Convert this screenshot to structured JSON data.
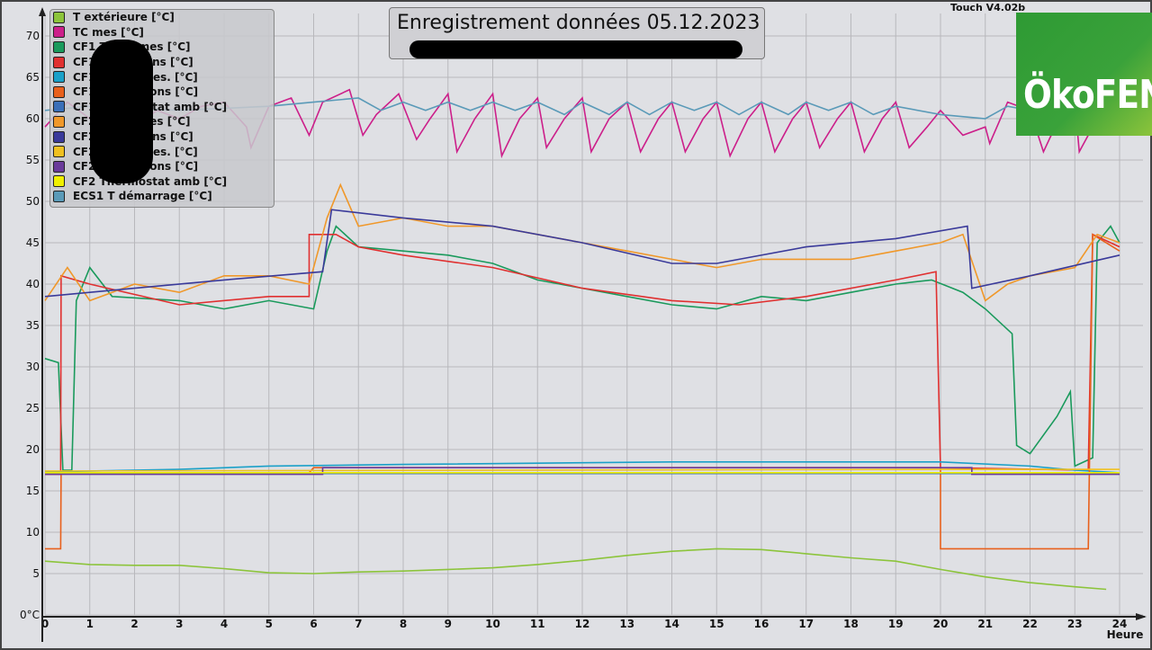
{
  "header": {
    "title": "Enregistrement données  05.12.2023",
    "version": "Touch V4.02b",
    "logo": "ÖkoFEN"
  },
  "chart_data": {
    "type": "line",
    "title": "Enregistrement données  05.12.2023",
    "xlabel": "Heure",
    "ylabel": "°C",
    "xlim": [
      0,
      24
    ],
    "ylim": [
      0,
      70
    ],
    "xticks": [
      "0",
      "1",
      "2",
      "3",
      "4",
      "5",
      "6",
      "7",
      "8",
      "9",
      "10",
      "11",
      "12",
      "13",
      "14",
      "15",
      "16",
      "17",
      "18",
      "19",
      "20",
      "21",
      "22",
      "23",
      "24"
    ],
    "yticks": [
      "0°C",
      "5",
      "10",
      "15",
      "20",
      "25",
      "30",
      "35",
      "40",
      "45",
      "50",
      "55",
      "60",
      "65",
      "70"
    ],
    "grid": true,
    "legend_position": "top-left",
    "series": [
      {
        "name": "T extérieure [°C]",
        "color": "#8cc43b",
        "points": [
          [
            0,
            6.5
          ],
          [
            1,
            6.1
          ],
          [
            2,
            6
          ],
          [
            3,
            6
          ],
          [
            4,
            5.6
          ],
          [
            5,
            5.1
          ],
          [
            6,
            5
          ],
          [
            7,
            5.2
          ],
          [
            8,
            5.3
          ],
          [
            9,
            5.5
          ],
          [
            10,
            5.7
          ],
          [
            11,
            6.1
          ],
          [
            12,
            6.6
          ],
          [
            13,
            7.2
          ],
          [
            14,
            7.7
          ],
          [
            15,
            8
          ],
          [
            16,
            7.9
          ],
          [
            17,
            7.4
          ],
          [
            18,
            6.9
          ],
          [
            19,
            6.5
          ],
          [
            20,
            5.5
          ],
          [
            21,
            4.6
          ],
          [
            22,
            3.9
          ],
          [
            23,
            3.4
          ],
          [
            23.7,
            3.1
          ]
        ]
      },
      {
        "name": "TC mes [°C]",
        "color": "#cc1f8a",
        "points": [
          [
            0,
            59
          ],
          [
            0.5,
            62
          ],
          [
            1,
            60
          ],
          [
            1.5,
            62
          ],
          [
            2,
            59
          ],
          [
            2.5,
            61
          ],
          [
            3,
            60
          ],
          [
            3.5,
            61.5
          ],
          [
            4,
            62
          ],
          [
            4.5,
            59
          ],
          [
            4.6,
            56.5
          ],
          [
            5,
            61.5
          ],
          [
            5.5,
            62.5
          ],
          [
            5.9,
            58
          ],
          [
            6.2,
            62
          ],
          [
            6.8,
            63.5
          ],
          [
            7.1,
            58
          ],
          [
            7.4,
            60.5
          ],
          [
            7.9,
            63
          ],
          [
            8.3,
            57.5
          ],
          [
            8.6,
            60
          ],
          [
            9,
            63
          ],
          [
            9.2,
            56
          ],
          [
            9.6,
            60
          ],
          [
            10,
            63
          ],
          [
            10.2,
            55.5
          ],
          [
            10.6,
            60
          ],
          [
            11,
            62.5
          ],
          [
            11.2,
            56.5
          ],
          [
            11.6,
            60
          ],
          [
            12,
            62.5
          ],
          [
            12.2,
            56
          ],
          [
            12.6,
            60
          ],
          [
            13,
            62
          ],
          [
            13.3,
            56
          ],
          [
            13.7,
            60
          ],
          [
            14,
            62
          ],
          [
            14.3,
            56
          ],
          [
            14.7,
            60
          ],
          [
            15,
            62
          ],
          [
            15.3,
            55.5
          ],
          [
            15.7,
            60
          ],
          [
            16,
            62
          ],
          [
            16.3,
            56
          ],
          [
            16.7,
            60
          ],
          [
            17,
            62
          ],
          [
            17.3,
            56.5
          ],
          [
            17.7,
            60
          ],
          [
            18,
            62
          ],
          [
            18.3,
            56
          ],
          [
            18.7,
            60
          ],
          [
            19,
            62
          ],
          [
            19.3,
            56.5
          ],
          [
            19.7,
            59
          ],
          [
            20,
            61
          ],
          [
            20.5,
            58
          ],
          [
            21,
            59
          ],
          [
            21.1,
            57
          ],
          [
            21.5,
            62
          ],
          [
            22,
            61
          ],
          [
            22.3,
            56
          ],
          [
            22.6,
            59.5
          ],
          [
            23,
            62
          ],
          [
            23.1,
            56
          ],
          [
            23.5,
            60
          ],
          [
            24,
            62.5
          ]
        ]
      },
      {
        "name": "CF1 T Dep mes [°C]",
        "color": "#1a9a5c",
        "points": [
          [
            0,
            31
          ],
          [
            0.3,
            30.5
          ],
          [
            0.4,
            17.5
          ],
          [
            0.6,
            17.5
          ],
          [
            0.7,
            38
          ],
          [
            1,
            42
          ],
          [
            1.5,
            38.5
          ],
          [
            3,
            38
          ],
          [
            4,
            37
          ],
          [
            5,
            38
          ],
          [
            6,
            37
          ],
          [
            6.3,
            44
          ],
          [
            6.5,
            47
          ],
          [
            7,
            44.5
          ],
          [
            8,
            44
          ],
          [
            9,
            43.5
          ],
          [
            10,
            42.5
          ],
          [
            11,
            40.5
          ],
          [
            12,
            39.5
          ],
          [
            13,
            38.5
          ],
          [
            14,
            37.5
          ],
          [
            15,
            37
          ],
          [
            16,
            38.5
          ],
          [
            17,
            38
          ],
          [
            18,
            39
          ],
          [
            19,
            40
          ],
          [
            19.8,
            40.5
          ],
          [
            20.5,
            39
          ],
          [
            21,
            37
          ],
          [
            21.6,
            34
          ],
          [
            21.7,
            20.5
          ],
          [
            22,
            19.5
          ],
          [
            22.6,
            24
          ],
          [
            22.9,
            27
          ],
          [
            23,
            18
          ],
          [
            23.4,
            19
          ],
          [
            23.5,
            45
          ],
          [
            23.8,
            47
          ],
          [
            24,
            45
          ]
        ]
      },
      {
        "name": "CF1 T Dep cons [°C]",
        "color": "#e03030",
        "points": [
          [
            0,
            17
          ],
          [
            0.35,
            17
          ],
          [
            0.36,
            41
          ],
          [
            1,
            40
          ],
          [
            3,
            37.5
          ],
          [
            5,
            38.5
          ],
          [
            5.9,
            38.5
          ],
          [
            5.9,
            46
          ],
          [
            6.5,
            46
          ],
          [
            7,
            44.5
          ],
          [
            8,
            43.5
          ],
          [
            10,
            42
          ],
          [
            12,
            39.5
          ],
          [
            14,
            38
          ],
          [
            15.5,
            37.5
          ],
          [
            17,
            38.5
          ],
          [
            19,
            40.5
          ],
          [
            19.9,
            41.5
          ],
          [
            20,
            17.8
          ],
          [
            23.3,
            17.5
          ],
          [
            23.4,
            46
          ],
          [
            24,
            44.5
          ]
        ]
      },
      {
        "name": "CF1 T Amb mes. [°C]",
        "color": "#1aa0c8",
        "points": [
          [
            0,
            17.3
          ],
          [
            1,
            17.4
          ],
          [
            3,
            17.6
          ],
          [
            5,
            18
          ],
          [
            8,
            18.2
          ],
          [
            14,
            18.5
          ],
          [
            20,
            18.5
          ],
          [
            22,
            18
          ],
          [
            23,
            17.5
          ],
          [
            24,
            17.2
          ]
        ]
      },
      {
        "name": "CF1 T Amb Cons [°C]",
        "color": "#e8601c",
        "points": [
          [
            0,
            8
          ],
          [
            0.35,
            8
          ],
          [
            0.36,
            17.2
          ],
          [
            5.9,
            17.2
          ],
          [
            6,
            17.8
          ],
          [
            20,
            17.8
          ],
          [
            20,
            8
          ],
          [
            23.3,
            8
          ],
          [
            23.4,
            46
          ],
          [
            24,
            44
          ]
        ]
      },
      {
        "name": "CF1 Thermostat amb [°C]",
        "color": "#3a6fb8",
        "points": [
          [
            0,
            17.1
          ],
          [
            24,
            17.1
          ]
        ]
      },
      {
        "name": "CF2 T Dep mes [°C]",
        "color": "#f0982a",
        "points": [
          [
            0,
            38
          ],
          [
            0.5,
            42
          ],
          [
            1,
            38
          ],
          [
            2,
            40
          ],
          [
            3,
            39
          ],
          [
            4,
            41
          ],
          [
            5,
            41
          ],
          [
            5.9,
            40
          ],
          [
            6.3,
            48
          ],
          [
            6.6,
            52
          ],
          [
            7,
            47
          ],
          [
            8,
            48
          ],
          [
            9,
            47
          ],
          [
            10,
            47
          ],
          [
            11,
            46
          ],
          [
            12,
            45
          ],
          [
            13,
            44
          ],
          [
            14,
            43
          ],
          [
            15,
            42
          ],
          [
            16,
            43
          ],
          [
            17,
            43
          ],
          [
            18,
            43
          ],
          [
            19,
            44
          ],
          [
            20,
            45
          ],
          [
            20.5,
            46
          ],
          [
            21,
            38
          ],
          [
            21.5,
            40
          ],
          [
            22,
            41
          ],
          [
            23,
            42
          ],
          [
            23.5,
            46
          ],
          [
            24,
            45
          ]
        ]
      },
      {
        "name": "CF2 T Dep cons [°C]",
        "color": "#3a3a9a",
        "points": [
          [
            0,
            38.5
          ],
          [
            2,
            39.5
          ],
          [
            4,
            40.5
          ],
          [
            6.2,
            41.5
          ],
          [
            6.4,
            49
          ],
          [
            8,
            48
          ],
          [
            10,
            47
          ],
          [
            12,
            45
          ],
          [
            14,
            42.5
          ],
          [
            15,
            42.5
          ],
          [
            17,
            44.5
          ],
          [
            19,
            45.5
          ],
          [
            20.6,
            47
          ],
          [
            20.7,
            39.5
          ],
          [
            22,
            41
          ],
          [
            24,
            43.5
          ]
        ]
      },
      {
        "name": "CF2 T Amb mes. [°C]",
        "color": "#f0c020",
        "points": [
          [
            0,
            17.4
          ],
          [
            20,
            17.6
          ],
          [
            24,
            17.6
          ]
        ]
      },
      {
        "name": "CF2 T Amb Cons [°C]",
        "color": "#6a3a9a",
        "points": [
          [
            0,
            17
          ],
          [
            6.2,
            17
          ],
          [
            6.2,
            17.8
          ],
          [
            20.7,
            17.8
          ],
          [
            20.7,
            17
          ],
          [
            24,
            17
          ]
        ]
      },
      {
        "name": "CF2 Thermostat amb [°C]",
        "color": "#f0f000",
        "points": [
          [
            0,
            17.2
          ],
          [
            24,
            17.2
          ]
        ]
      },
      {
        "name": "ECS1 T démarrage [°C]",
        "color": "#5a9ab8",
        "points": [
          [
            0,
            61
          ],
          [
            1,
            61.5
          ],
          [
            3,
            61
          ],
          [
            5,
            61.5
          ],
          [
            6,
            62
          ],
          [
            7,
            62.5
          ],
          [
            7.5,
            61
          ],
          [
            8,
            62
          ],
          [
            8.5,
            61
          ],
          [
            9,
            62
          ],
          [
            9.5,
            61
          ],
          [
            10,
            62
          ],
          [
            10.5,
            61
          ],
          [
            11,
            62
          ],
          [
            11.6,
            60.5
          ],
          [
            12,
            62
          ],
          [
            12.6,
            60.5
          ],
          [
            13,
            62
          ],
          [
            13.5,
            60.5
          ],
          [
            14,
            62
          ],
          [
            14.5,
            61
          ],
          [
            15,
            62
          ],
          [
            15.5,
            60.5
          ],
          [
            16,
            62
          ],
          [
            16.6,
            60.5
          ],
          [
            17,
            62
          ],
          [
            17.5,
            61
          ],
          [
            18,
            62
          ],
          [
            18.5,
            60.5
          ],
          [
            19,
            61.5
          ],
          [
            20,
            60.5
          ],
          [
            21,
            60
          ],
          [
            21.5,
            61.5
          ],
          [
            22,
            61
          ],
          [
            23,
            60
          ],
          [
            23.5,
            61
          ],
          [
            24,
            62
          ]
        ]
      }
    ]
  }
}
